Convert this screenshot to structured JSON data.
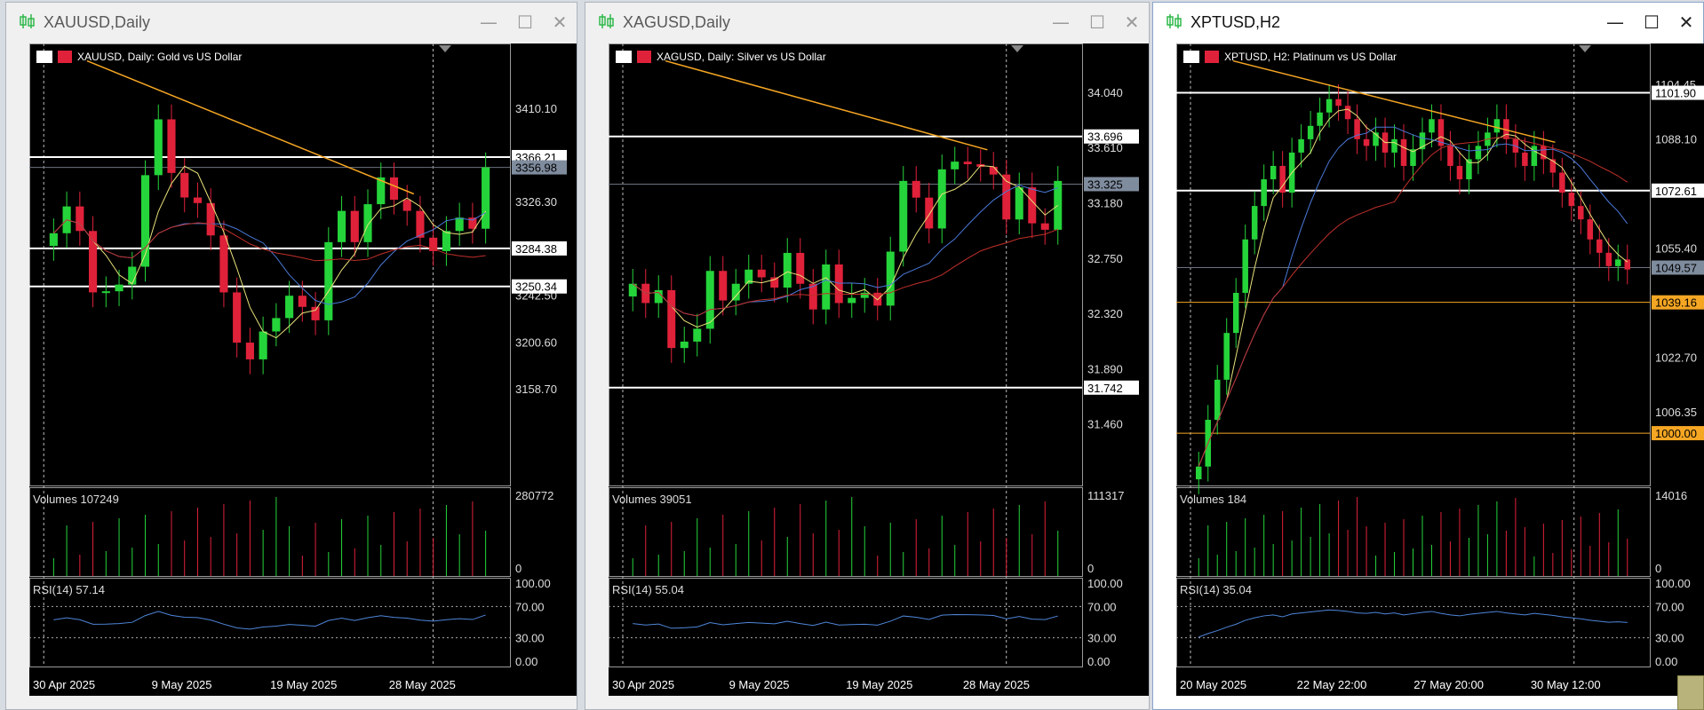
{
  "windows": [
    {
      "id": "xau",
      "title": "XAUUSD,Daily",
      "active": false,
      "info_label": "XAUUSD, Daily:  Gold vs US Dollar",
      "price_ticks": [
        "3410.10",
        "3326.30",
        "3242.50",
        "3200.60",
        "3158.70"
      ],
      "levels": [
        {
          "label": "3366.21",
          "value": 3366.21,
          "style": "white"
        },
        {
          "label": "3356.98",
          "value": 3356.98,
          "style": "current"
        },
        {
          "label": "3284.38",
          "value": 3284.38,
          "style": "white"
        },
        {
          "label": "3250.34",
          "value": 3250.34,
          "style": "white"
        }
      ],
      "volumes_label": "Volumes 107249",
      "volume_ticks": [
        "280772",
        "0"
      ],
      "rsi_label": "RSI(14) 57.14",
      "rsi_ticks": [
        "100.00",
        "70.00",
        "30.00",
        "0.00"
      ],
      "date_ticks": [
        "30 Apr 2025",
        "9 May 2025",
        "19 May 2025",
        "28 May 2025"
      ]
    },
    {
      "id": "xag",
      "title": "XAGUSD,Daily",
      "active": false,
      "info_label": "XAGUSD, Daily:  Silver vs US Dollar",
      "price_ticks": [
        "34.040",
        "33.610",
        "33.180",
        "32.750",
        "32.320",
        "31.890",
        "31.460"
      ],
      "levels": [
        {
          "label": "33.696",
          "value": 33.696,
          "style": "white"
        },
        {
          "label": "33.325",
          "value": 33.325,
          "style": "current"
        },
        {
          "label": "31.742",
          "value": 31.742,
          "style": "white"
        }
      ],
      "volumes_label": "Volumes 39051",
      "volume_ticks": [
        "111317",
        "0"
      ],
      "rsi_label": "RSI(14) 55.04",
      "rsi_ticks": [
        "100.00",
        "70.00",
        "30.00",
        "0.00"
      ],
      "date_ticks": [
        "30 Apr 2025",
        "9 May 2025",
        "19 May 2025",
        "28 May 2025"
      ]
    },
    {
      "id": "xpt",
      "title": "XPTUSD,H2",
      "active": true,
      "info_label": "XPTUSD, H2:  Platinum vs US Dollar",
      "price_ticks": [
        "1104.45",
        "1088.10",
        "1055.40",
        "1022.70",
        "1006.35"
      ],
      "levels": [
        {
          "label": "1101.90",
          "value": 1101.9,
          "style": "white"
        },
        {
          "label": "1072.61",
          "value": 1072.61,
          "style": "white"
        },
        {
          "label": "1049.57",
          "value": 1049.57,
          "style": "current"
        },
        {
          "label": "1039.16",
          "value": 1039.16,
          "style": "orange"
        },
        {
          "label": "1000.00",
          "value": 1000.0,
          "style": "orange"
        }
      ],
      "volumes_label": "Volumes 184",
      "volume_ticks": [
        "14016",
        "0"
      ],
      "rsi_label": "RSI(14) 35.04",
      "rsi_ticks": [
        "100.00",
        "70.00",
        "30.00",
        "0.00"
      ],
      "date_ticks": [
        "20 May 2025",
        "22 May 22:00",
        "27 May 20:00",
        "30 May 12:00"
      ]
    }
  ],
  "window_buttons": {
    "minimize": "—",
    "maximize": "☐",
    "close": "✕"
  },
  "colors": {
    "bull": "#25d43a",
    "bear": "#e0213a",
    "background": "#000000",
    "grid": "#555555",
    "orange": "#f5a623",
    "current_label_bg": "#7f8c9e",
    "ma_yellow": "#e8e27a",
    "ma_blue": "#4a79d8",
    "ma_red": "#c0302a",
    "rsi_line": "#4f86d9"
  }
}
